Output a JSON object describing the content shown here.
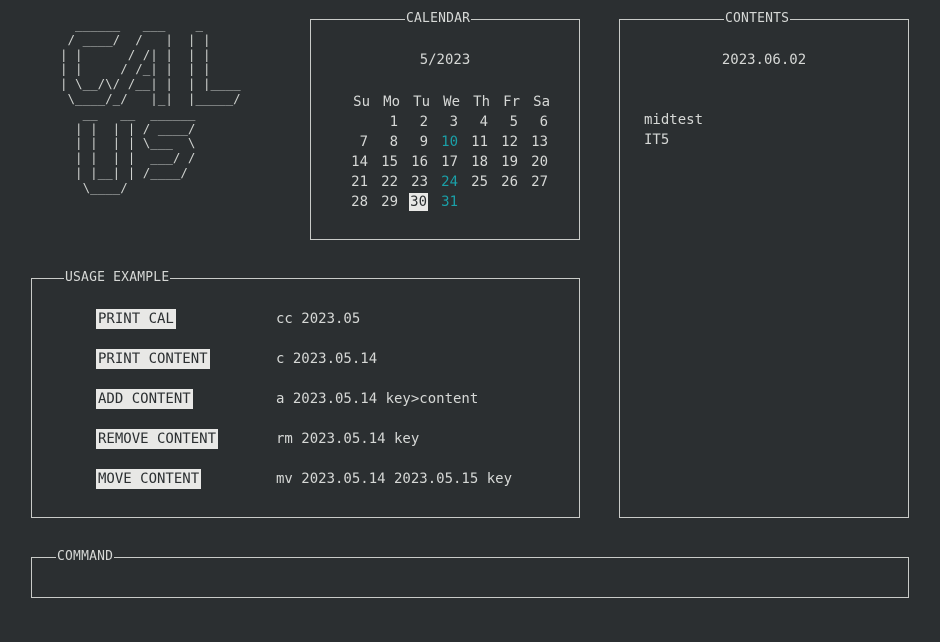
{
  "logo_text": "  ______   ___    _\n / ____/  /   |  | |\n| |      / /| |  | |\n| |     / /_| |  | |\n| \\__/\\/ /__| |  | |____\n \\____/_/   |_|  |_____/\n   __   __  ______\n  | |  | | / ____/\n  | |  | | \\___  \\\n  | |  | |  ___/ /\n  | |__| | /____/\n   \\____/",
  "calendar": {
    "title": "CALENDAR",
    "month_label": "5/2023",
    "weekdays": [
      "Su",
      "Mo",
      "Tu",
      "We",
      "Th",
      "Fr",
      "Sa"
    ],
    "start_offset": 1,
    "days": [
      "1",
      "2",
      "3",
      "4",
      "5",
      "6",
      "7",
      "8",
      "9",
      "10",
      "11",
      "12",
      "13",
      "14",
      "15",
      "16",
      "17",
      "18",
      "19",
      "20",
      "21",
      "22",
      "23",
      "24",
      "25",
      "26",
      "27",
      "28",
      "29",
      "30",
      "31"
    ],
    "marked_days": [
      "10",
      "24",
      "31"
    ],
    "today": "30",
    "marked_color": "#1aa0a8"
  },
  "contents": {
    "title": "CONTENTS",
    "date": "2023.06.02",
    "items": [
      "midtest",
      "IT5"
    ]
  },
  "usage": {
    "title": "USAGE EXAMPLE",
    "rows": [
      {
        "label": "PRINT CAL",
        "command": "cc 2023.05"
      },
      {
        "label": "PRINT CONTENT",
        "command": "c 2023.05.14"
      },
      {
        "label": "ADD CONTENT",
        "command": "a 2023.05.14 key>content"
      },
      {
        "label": "REMOVE CONTENT",
        "command": "rm 2023.05.14 key"
      },
      {
        "label": "MOVE CONTENT",
        "command": "mv 2023.05.14 2023.05.15 key"
      }
    ]
  },
  "command": {
    "title": "COMMAND",
    "value": ""
  },
  "colors": {
    "background": "#2b2f31",
    "foreground": "#d6d8d6",
    "highlight_bg": "#e8e8e6",
    "accent": "#1aa0a8"
  }
}
